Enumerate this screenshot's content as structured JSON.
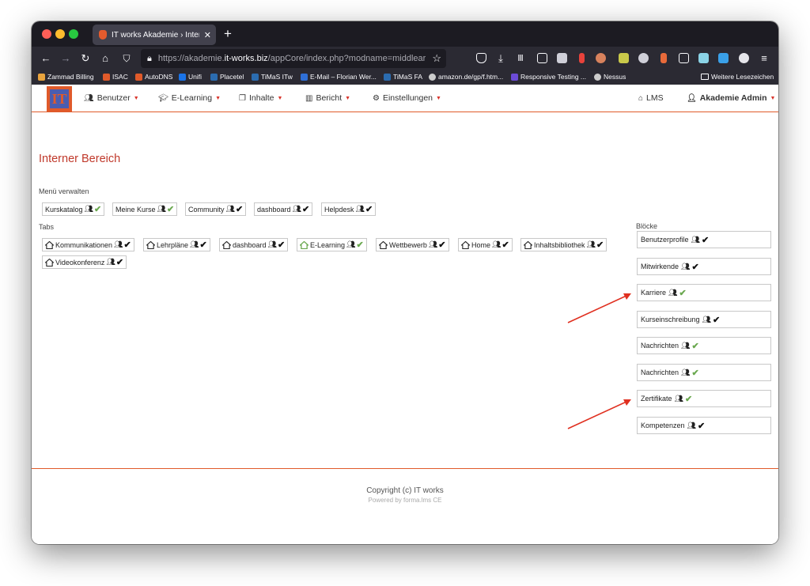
{
  "browser": {
    "tab_title": "IT works Akademie › Interner Be",
    "url_prefix": "https://akademie.",
    "url_host": "it-works.biz",
    "url_path": "/appCore/index.php?modname=middlear",
    "bookmarks": [
      {
        "label": "Zammad Billing",
        "color": "#e8a33d"
      },
      {
        "label": "ISAC",
        "color": "#e05a2a"
      },
      {
        "label": "AutoDNS",
        "color": "#e05a2a"
      },
      {
        "label": "Unifi",
        "color": "#1a73e8"
      },
      {
        "label": "Placetel",
        "color": "#2b6cb0"
      },
      {
        "label": "TiMaS ITw",
        "color": "#2b6cb0"
      },
      {
        "label": "E-Mail – Florian Wer...",
        "color": "#2f6fd6"
      },
      {
        "label": "TiMaS FA",
        "color": "#2b6cb0"
      },
      {
        "label": "amazon.de/gp/f.htm...",
        "color": "#cccccc"
      },
      {
        "label": "Responsive Testing ...",
        "color": "#6c4bd6"
      },
      {
        "label": "Nessus",
        "color": "#cccccc"
      }
    ],
    "other_bookmarks": "Weitere Lesezeichen"
  },
  "header": {
    "logo_text": "IT",
    "menu": [
      {
        "label": "Benutzer",
        "icon": "users-icon"
      },
      {
        "label": "E-Learning",
        "icon": "graduation-cap-icon"
      },
      {
        "label": "Inhalte",
        "icon": "files-icon"
      },
      {
        "label": "Bericht",
        "icon": "bar-chart-icon"
      },
      {
        "label": "Einstellungen",
        "icon": "gears-icon"
      }
    ],
    "lms_label": "LMS",
    "admin_label": "Akademie Admin"
  },
  "main": {
    "title": "Interner Bereich",
    "menu_section_label": "Menü verwalten",
    "menu_items": [
      {
        "label": "Kurskatalog",
        "check": "green"
      },
      {
        "label": "Meine Kurse",
        "check": "green"
      },
      {
        "label": "Community",
        "check": "black"
      },
      {
        "label": "dashboard",
        "check": "black"
      },
      {
        "label": "Helpdesk",
        "check": "black"
      }
    ],
    "tabs_section_label": "Tabs",
    "tabs": [
      {
        "label": "Kommunikationen",
        "check": "black",
        "house": "black"
      },
      {
        "label": "Lehrpläne",
        "check": "black",
        "house": "black"
      },
      {
        "label": "dashboard",
        "check": "black",
        "house": "black"
      },
      {
        "label": "E-Learning",
        "check": "green",
        "house": "green"
      },
      {
        "label": "Wettbewerb",
        "check": "black",
        "house": "black"
      },
      {
        "label": "Home",
        "check": "black",
        "house": "black"
      },
      {
        "label": "Inhaltsbibliothek",
        "check": "black",
        "house": "black"
      },
      {
        "label": "Videokonferenz",
        "check": "black",
        "house": "black"
      }
    ],
    "blocks_section_label": "Blöcke",
    "blocks": [
      {
        "label": "Benutzerprofile",
        "check": "black"
      },
      {
        "label": "Mitwirkende",
        "check": "black"
      },
      {
        "label": "Karriere",
        "check": "green"
      },
      {
        "label": "Kurseinschreibung",
        "check": "black"
      },
      {
        "label": "Nachrichten",
        "check": "green"
      },
      {
        "label": "Nachrichten",
        "check": "green"
      },
      {
        "label": "Zertifikate",
        "check": "green"
      },
      {
        "label": "Kompetenzen",
        "check": "black"
      }
    ]
  },
  "footer": {
    "copyright": "Copyright (c) IT works",
    "powered": "Powered by forma.lms CE"
  },
  "colors": {
    "accent": "#e05a2a",
    "title_red": "#c0392b",
    "check_green": "#6aa84f",
    "annotation_arrow": "#e03020"
  }
}
